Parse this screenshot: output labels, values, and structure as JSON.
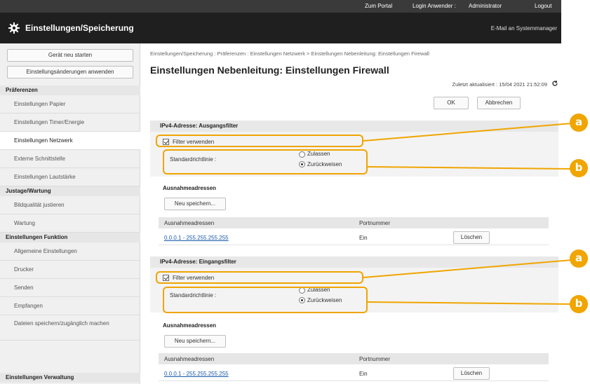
{
  "topbar": {
    "portal": "Zum Portal",
    "login": "Login Anwender :",
    "user": "Administrator",
    "logout": "Logout"
  },
  "app": {
    "title": "Einstellungen/Speicherung",
    "mail": "E-Mail an Systemmanager"
  },
  "sidebar": {
    "restart_button": "Gerät neu starten",
    "apply_button": "Einstellungsänderungen anwenden",
    "groups": {
      "preferences": "Präferenzen",
      "adjustment": "Justage/Wartung",
      "function": "Einstellungen Funktion",
      "management": "Einstellungen Verwaltung"
    },
    "items": {
      "paper": "Einstellungen Papier",
      "timer": "Einstellungen Timer/Energie",
      "network": "Einstellungen Netzwerk",
      "external": "Externe Schnittstelle",
      "volume": "Einstellungen Lautstärke",
      "image_quality": "Bildqualität justieren",
      "maintenance": "Wartung",
      "general": "Allgemeine Einstellungen",
      "printer": "Drucker",
      "send": "Senden",
      "receive": "Empfangen",
      "file_access": "Dateien speichern/zugänglich machen"
    }
  },
  "main": {
    "breadcrumb": "Einstellungen/Speicherung : Präferenzen : Einstellungen Netzwerk > Einstellungen Nebenleitung: Einstellungen Firewall",
    "title": "Einstellungen Nebenleitung: Einstellungen Firewall",
    "updated": "Zuletzt aktualisiert : 15/04 2021 21:52:09",
    "ok_button": "OK",
    "cancel_button": "Abbrechen",
    "sections": [
      {
        "header": "IPv4-Adresse: Ausgangsfilter",
        "use_filter": "Filter verwenden",
        "policy_label": "Standardrichtlinie :",
        "option_allow": "Zulassen",
        "option_deny": "Zurückweisen",
        "exceptions_title": "Ausnahmeadressen",
        "register_button": "Neu speichern...",
        "col_address": "Ausnahmeadressen",
        "col_port": "Portnummer",
        "row_address": "0.0.0.1 - 255.255.255.255",
        "row_port": "Ein",
        "delete_button": "Löschen"
      },
      {
        "header": "IPv4-Adresse: Eingangsfilter",
        "use_filter": "Filter verwenden",
        "policy_label": "Standardrichtlinie :",
        "option_allow": "Zulassen",
        "option_deny": "Zurückweisen",
        "exceptions_title": "Ausnahmeadressen",
        "register_button": "Neu speichern...",
        "col_address": "Ausnahmeadressen",
        "col_port": "Portnummer",
        "row_address": "0.0.0.1 - 255.255.255.255",
        "row_port": "Ein",
        "delete_button": "Löschen"
      }
    ]
  },
  "callouts": {
    "a": "a",
    "b": "b",
    "color": "#f0a500"
  }
}
